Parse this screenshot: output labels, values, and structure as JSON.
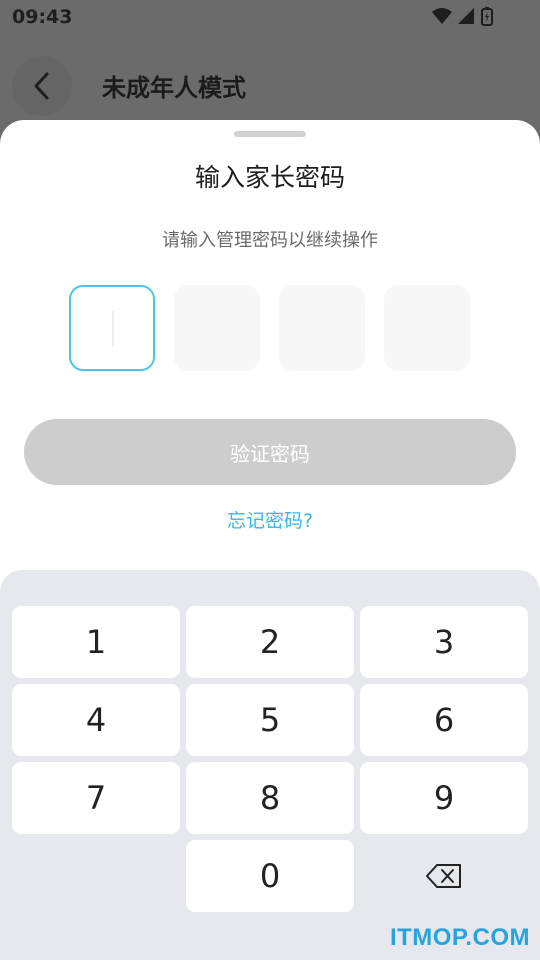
{
  "status_bar": {
    "time": "09:43"
  },
  "background_page": {
    "title": "未成年人模式"
  },
  "sheet": {
    "title": "输入家长密码",
    "subtitle": "请输入管理密码以继续操作",
    "verify_label": "验证密码",
    "forgot_label": "忘记密码?"
  },
  "keypad": {
    "keys": [
      "1",
      "2",
      "3",
      "4",
      "5",
      "6",
      "7",
      "8",
      "9",
      "0"
    ]
  },
  "watermark": "ITMOP.COM",
  "colors": {
    "accent": "#4fc3e8",
    "link": "#3ab7e4",
    "disabled_button": "#cdcdcd",
    "keypad_bg": "#e6e8ed"
  }
}
